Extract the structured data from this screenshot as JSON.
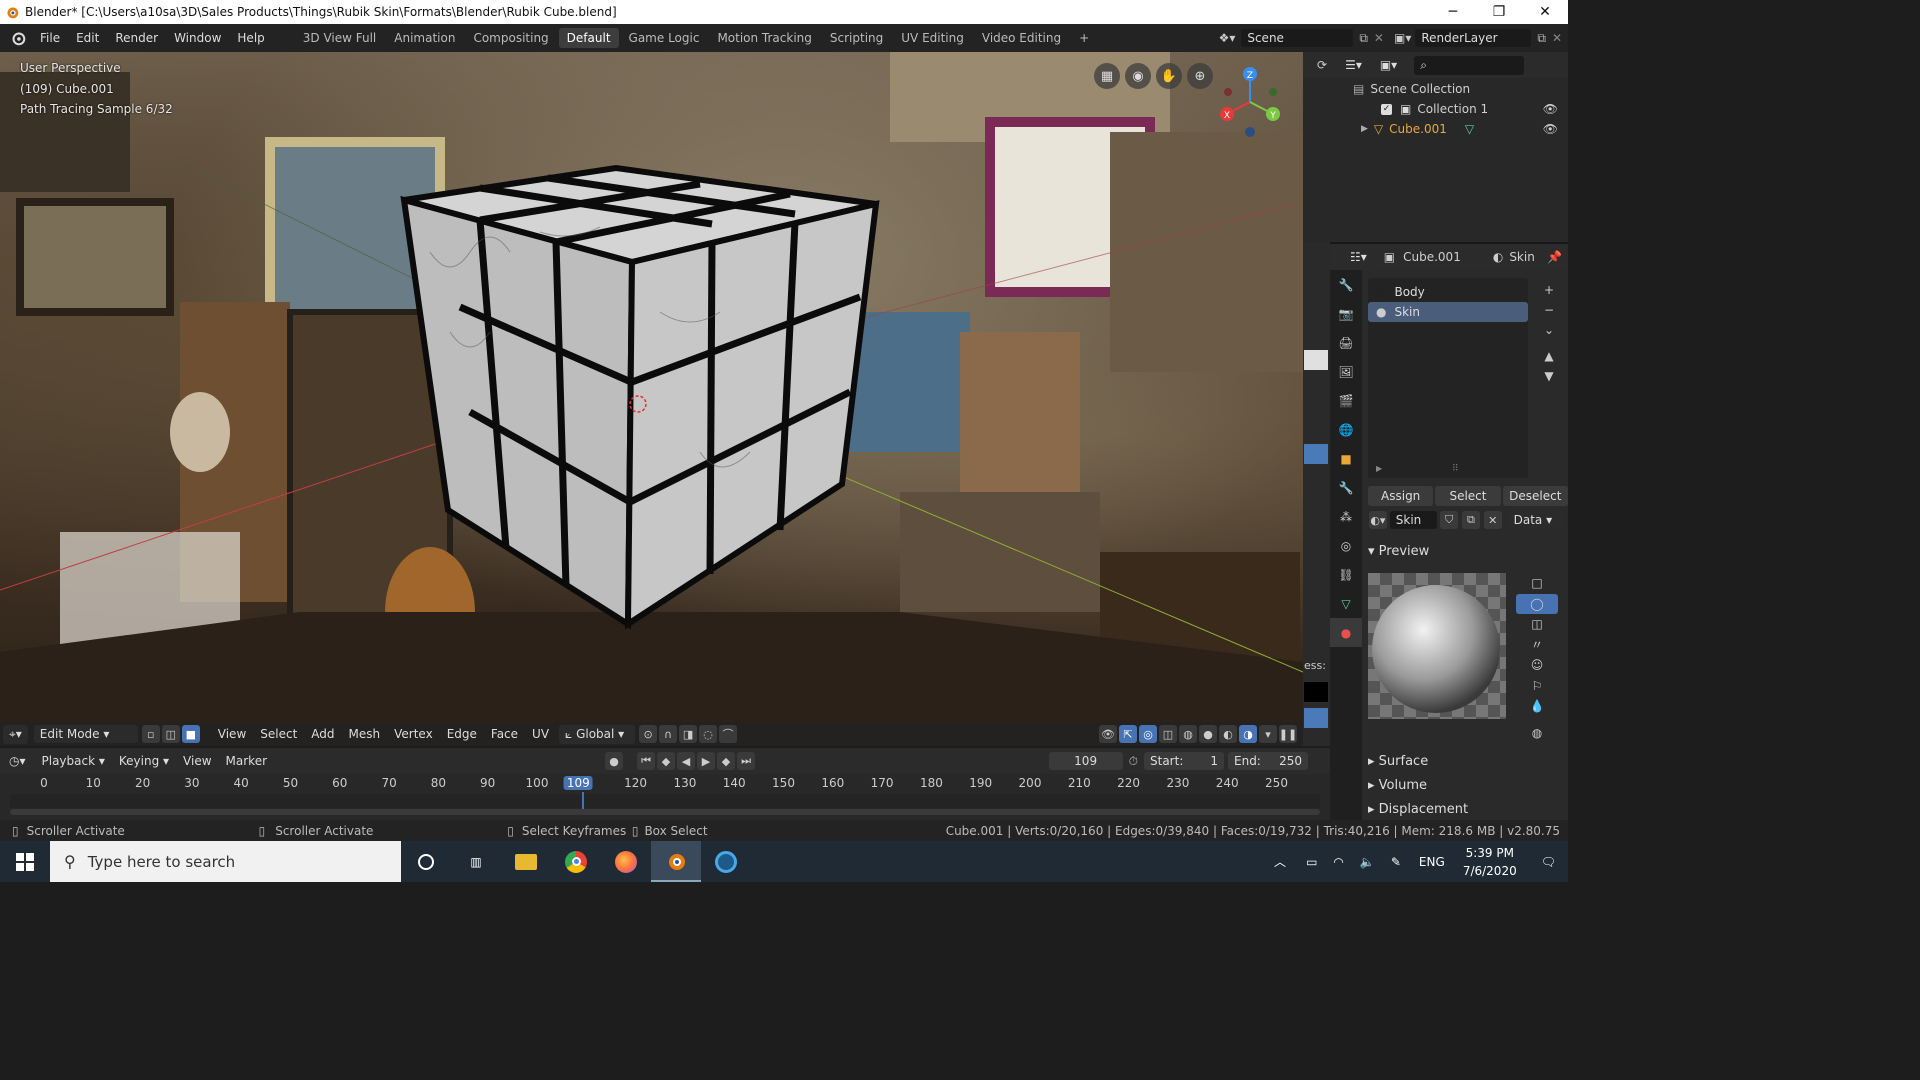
{
  "window": {
    "title": "Blender* [C:\\Users\\a10sa\\3D\\Sales Products\\Things\\Rubik Skin\\Formats\\Blender\\Rubik Cube.blend]",
    "minimize": "─",
    "maximize": "❐",
    "close": "✕"
  },
  "menu": [
    "File",
    "Edit",
    "Render",
    "Window",
    "Help"
  ],
  "workspaces": [
    "3D View Full",
    "Animation",
    "Compositing",
    "Default",
    "Game Logic",
    "Motion Tracking",
    "Scripting",
    "UV Editing",
    "Video Editing",
    "+"
  ],
  "active_workspace": "Default",
  "scene": {
    "name": "Scene",
    "render_layer": "RenderLayer"
  },
  "viewport": {
    "perspective": "User Perspective",
    "object": "(109) Cube.001",
    "render_status": "Path Tracing Sample 6/32",
    "axis_x": "X",
    "axis_y": "Y",
    "axis_z": "Z"
  },
  "viewport_header": {
    "mode": "Edit Mode",
    "menus": [
      "View",
      "Select",
      "Add",
      "Mesh",
      "Vertex",
      "Edge",
      "Face",
      "UV"
    ],
    "orientation": "Global"
  },
  "timeline": {
    "menus": [
      "Playback",
      "Keying",
      "View",
      "Marker"
    ],
    "current_frame": "109",
    "start_label": "Start:",
    "start": "1",
    "end_label": "End:",
    "end": "250",
    "ticks": [
      "0",
      "10",
      "20",
      "30",
      "40",
      "50",
      "60",
      "70",
      "80",
      "90",
      "100",
      "109",
      "120",
      "130",
      "140",
      "150",
      "160",
      "170",
      "180",
      "190",
      "200",
      "210",
      "220",
      "230",
      "240",
      "250"
    ]
  },
  "status": {
    "left1": "Scroller Activate",
    "left2": "Scroller Activate",
    "mid1": "Select Keyframes",
    "mid2": "Box Select",
    "stats": "Cube.001 | Verts:0/20,160 | Edges:0/39,840 | Faces:0/19,732 | Tris:40,216 | Mem: 218.6 MB | v2.80.75"
  },
  "outliner": {
    "root": "Scene Collection",
    "collection": "Collection 1",
    "object": "Cube.001"
  },
  "properties": {
    "object": "Cube.001",
    "material": "Skin",
    "slots": [
      "Body",
      "Skin"
    ],
    "assign": "Assign",
    "select": "Select",
    "deselect": "Deselect",
    "mat_name": "Skin",
    "link": "Data",
    "sections": {
      "preview": "Preview",
      "surface": "Surface",
      "volume": "Volume",
      "displacement": "Displacement"
    },
    "partial_label": "ess:"
  },
  "taskbar": {
    "search_placeholder": "Type here to search",
    "time": "5:39 PM",
    "date": "7/6/2020",
    "lang": "ENG"
  },
  "colors": {
    "accent": "#4772b3",
    "selected_object": "#e8a838",
    "x_axis": "#e83a3a",
    "y_axis": "#7ac943",
    "z_axis": "#3a8ef0"
  }
}
